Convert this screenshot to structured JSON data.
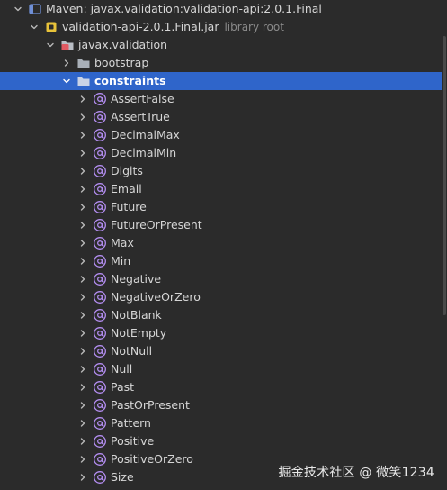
{
  "tree": {
    "rows": [
      {
        "label": "Maven: javax.validation:validation-api:2.0.1.Final",
        "icon": "library-icon",
        "expanded": true,
        "depth": 0
      },
      {
        "label": "validation-api-2.0.1.Final.jar",
        "suffix": "library root",
        "icon": "jar-icon",
        "expanded": true,
        "depth": 1
      },
      {
        "label": "javax.validation",
        "icon": "package-icon",
        "expanded": true,
        "depth": 2
      },
      {
        "label": "bootstrap",
        "icon": "folder-icon",
        "expanded": false,
        "depth": 3
      },
      {
        "label": "constraints",
        "icon": "folder-icon",
        "expanded": true,
        "depth": 3,
        "selected": true
      },
      {
        "label": "AssertFalse",
        "icon": "annotation-icon",
        "expanded": false,
        "depth": 4
      },
      {
        "label": "AssertTrue",
        "icon": "annotation-icon",
        "expanded": false,
        "depth": 4
      },
      {
        "label": "DecimalMax",
        "icon": "annotation-icon",
        "expanded": false,
        "depth": 4
      },
      {
        "label": "DecimalMin",
        "icon": "annotation-icon",
        "expanded": false,
        "depth": 4
      },
      {
        "label": "Digits",
        "icon": "annotation-icon",
        "expanded": false,
        "depth": 4
      },
      {
        "label": "Email",
        "icon": "annotation-icon",
        "expanded": false,
        "depth": 4
      },
      {
        "label": "Future",
        "icon": "annotation-icon",
        "expanded": false,
        "depth": 4
      },
      {
        "label": "FutureOrPresent",
        "icon": "annotation-icon",
        "expanded": false,
        "depth": 4
      },
      {
        "label": "Max",
        "icon": "annotation-icon",
        "expanded": false,
        "depth": 4
      },
      {
        "label": "Min",
        "icon": "annotation-icon",
        "expanded": false,
        "depth": 4
      },
      {
        "label": "Negative",
        "icon": "annotation-icon",
        "expanded": false,
        "depth": 4
      },
      {
        "label": "NegativeOrZero",
        "icon": "annotation-icon",
        "expanded": false,
        "depth": 4
      },
      {
        "label": "NotBlank",
        "icon": "annotation-icon",
        "expanded": false,
        "depth": 4
      },
      {
        "label": "NotEmpty",
        "icon": "annotation-icon",
        "expanded": false,
        "depth": 4
      },
      {
        "label": "NotNull",
        "icon": "annotation-icon",
        "expanded": false,
        "depth": 4
      },
      {
        "label": "Null",
        "icon": "annotation-icon",
        "expanded": false,
        "depth": 4
      },
      {
        "label": "Past",
        "icon": "annotation-icon",
        "expanded": false,
        "depth": 4
      },
      {
        "label": "PastOrPresent",
        "icon": "annotation-icon",
        "expanded": false,
        "depth": 4
      },
      {
        "label": "Pattern",
        "icon": "annotation-icon",
        "expanded": false,
        "depth": 4
      },
      {
        "label": "Positive",
        "icon": "annotation-icon",
        "expanded": false,
        "depth": 4
      },
      {
        "label": "PositiveOrZero",
        "icon": "annotation-icon",
        "expanded": false,
        "depth": 4
      },
      {
        "label": "Size",
        "icon": "annotation-icon",
        "expanded": false,
        "depth": 4
      }
    ]
  },
  "watermark": {
    "text": "掘金技术社区 @ 微笑1234"
  },
  "colors": {
    "background": "#2b2b2b",
    "selection": "#2f65ca",
    "text": "#d6d6d6",
    "muted_text": "#8a8a8a",
    "annotation_icon": "#b48ef2",
    "folder_icon": "#a9b0b8",
    "library_icon": "#6f8fd6",
    "jar_icon": "#e8c33a",
    "package_icon": "#e05a63"
  }
}
